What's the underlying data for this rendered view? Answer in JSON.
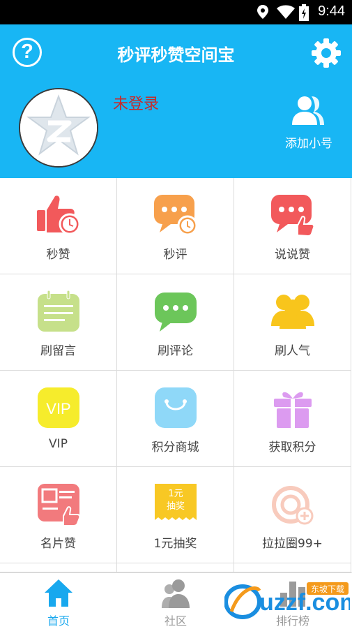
{
  "status_bar": {
    "time": "9:44",
    "icons": [
      "location-icon",
      "wifi-icon",
      "battery-icon"
    ]
  },
  "header": {
    "title": "秒评秒赞空间宝",
    "login_status": "未登录",
    "add_account_label": "添加小号",
    "background_color": "#18b6f4"
  },
  "grid": {
    "items": [
      {
        "label": "秒赞",
        "icon": "thumbs-up-clock-icon"
      },
      {
        "label": "秒评",
        "icon": "chat-clock-icon"
      },
      {
        "label": "说说赞",
        "icon": "chat-thumb-icon"
      },
      {
        "label": "刷留言",
        "icon": "notepad-icon"
      },
      {
        "label": "刷评论",
        "icon": "chat-bubble-icon"
      },
      {
        "label": "刷人气",
        "icon": "people-icon"
      },
      {
        "label": "VIP",
        "icon": "vip-icon",
        "icon_text": "VIP"
      },
      {
        "label": "积分商城",
        "icon": "shopping-bag-icon"
      },
      {
        "label": "获取积分",
        "icon": "gift-icon"
      },
      {
        "label": "名片赞",
        "icon": "card-thumb-icon"
      },
      {
        "label": "1元抽奖",
        "icon": "lottery-ticket-icon",
        "icon_text_1": "1元",
        "icon_text_2": "抽奖"
      },
      {
        "label": "拉拉圈99+",
        "icon": "circle-plus-icon"
      }
    ]
  },
  "tabbar": {
    "tabs": [
      {
        "label": "首页",
        "icon": "home-icon",
        "active": true,
        "color": "#18a8ee"
      },
      {
        "label": "社区",
        "icon": "community-icon",
        "active": false,
        "color": "#9a9a9a"
      },
      {
        "label": "排行榜",
        "icon": "ranking-icon",
        "active": false,
        "color": "#9a9a9a"
      }
    ]
  },
  "watermark": {
    "text": "uzzf.com",
    "subtext": "东坡下载"
  }
}
